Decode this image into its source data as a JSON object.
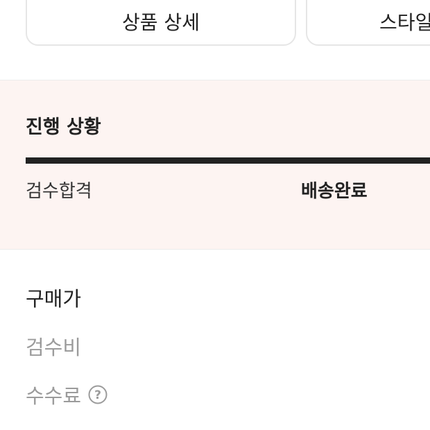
{
  "tabs": {
    "detail_label": "상품 상세",
    "style_label": "스타일"
  },
  "progress": {
    "title": "진행 상황",
    "progress_fraction": 1.0,
    "steps": [
      {
        "label": "검수합격",
        "active": false
      },
      {
        "label": "배송완료",
        "active": true
      }
    ]
  },
  "fees": {
    "purchase_price_label": "구매가",
    "inspection_fee_label": "검수비",
    "commission_label": "수수료",
    "commission_help_icon": "question-circle-icon"
  },
  "colors": {
    "progress_background": "#fdf4f2",
    "progress_bar": "#222222",
    "secondary_text": "#9b9b9b"
  }
}
